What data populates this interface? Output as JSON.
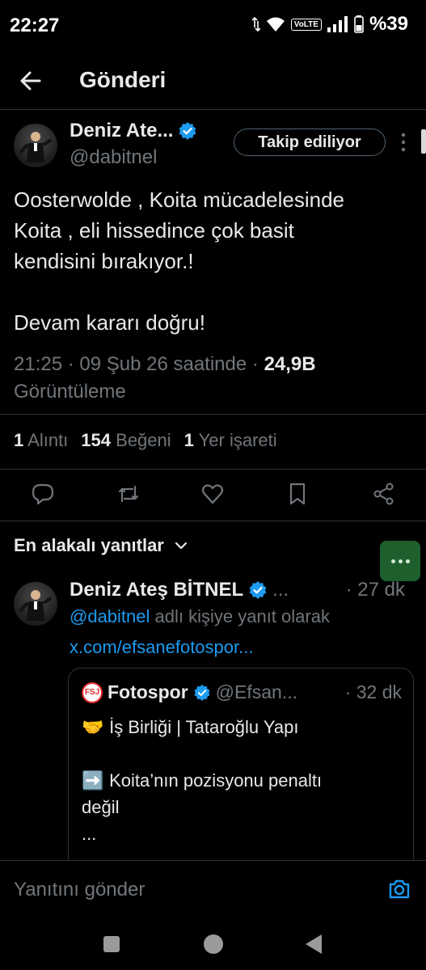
{
  "status_bar": {
    "time": "22:27",
    "volte": "VoLTE",
    "battery": "%39"
  },
  "header": {
    "title": "Gönderi",
    "back_icon": "arrow-left-icon"
  },
  "post": {
    "author_name": "Deniz Ate...",
    "author_handle": "@dabitnel",
    "follow_label": "Takip ediliyor",
    "text_lines": [
      "Oosterwolde , Koita mücadelesinde",
      "Koita , eli hissedince çok basit",
      "kendisini bırakıyor.!",
      "",
      "Devam kararı doğru!"
    ],
    "meta_time": "21:25 · 09 Şub 26 saatinde · ",
    "meta_views": "24,9B",
    "meta_views_label": "Görüntüleme",
    "stats": {
      "quotes_count": "1",
      "quotes_label": "Alıntı",
      "likes_count": "154",
      "likes_label": "Beğeni",
      "bookmarks_count": "1",
      "bookmarks_label": "Yer işareti"
    }
  },
  "replies_section": {
    "sort_label": "En alakalı yanıtlar"
  },
  "reply": {
    "author_name": "Deniz Ateş BİTNEL",
    "ellipsis": "...",
    "time": "· 27 dk",
    "context_mention": "@dabitnel",
    "context_suffix": " adlı kişiye yanıt olarak",
    "link": "x.com/efsanefotospor...",
    "quote": {
      "logo_text": "FSJ",
      "name": "Fotospor",
      "handle": "@Efsan...",
      "time": "· 32 dk",
      "line1_emoji": "🤝",
      "line1": " İş Birliği | Tataroğlu Yapı",
      "line2_emoji": "➡️",
      "line2": " Koita’nın pozisyonu penaltı",
      "line3": "değil",
      "line4": "..."
    }
  },
  "compose": {
    "placeholder": "Yanıtını gönder"
  },
  "colors": {
    "accent": "#1d9bf0",
    "text": "#e7e9ea",
    "muted": "#71767b",
    "divider": "#2f3336",
    "fab": "#1f5f2e"
  }
}
